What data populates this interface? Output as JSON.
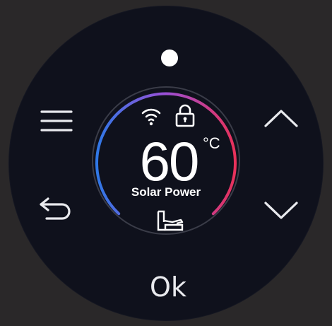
{
  "thermostat": {
    "temperature": "60",
    "unit": "°C",
    "mode_label": "Solar Power",
    "ok_label": "Ok"
  },
  "icons": {
    "menu": "hamburger-menu-icon",
    "back": "back-arrow-icon",
    "up": "chevron-up-icon",
    "down": "chevron-down-icon",
    "wifi": "wifi-icon",
    "lock": "lock-icon",
    "solar": "solar-tank-icon"
  },
  "colors": {
    "face_background": "#0f111c",
    "page_background": "#2a2829",
    "arc_cold": "#2f78e6",
    "arc_mid": "#9c4fd6",
    "arc_hot": "#e8315a",
    "foreground": "#e9eaee"
  }
}
